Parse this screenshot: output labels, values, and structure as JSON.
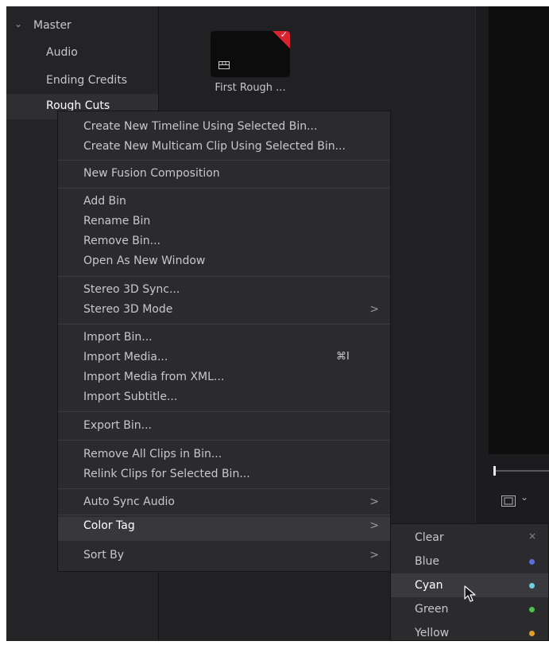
{
  "bins": {
    "master": "Master",
    "items": [
      "Audio",
      "Ending Credits",
      "Rough Cuts"
    ]
  },
  "clip": {
    "name": "First Rough ..."
  },
  "context_menu": {
    "create_timeline": "Create New Timeline Using Selected Bin...",
    "create_multicam": "Create New Multicam Clip Using Selected Bin...",
    "new_fusion": "New Fusion Composition",
    "add_bin": "Add Bin",
    "rename_bin": "Rename Bin",
    "remove_bin": "Remove Bin...",
    "open_window": "Open As New Window",
    "stereo_sync": "Stereo 3D Sync...",
    "stereo_mode": "Stereo 3D Mode",
    "import_bin": "Import Bin...",
    "import_media": "Import Media...",
    "import_media_shortcut": "⌘I",
    "import_xml": "Import Media from XML...",
    "import_subtitle": "Import Subtitle...",
    "export_bin": "Export Bin...",
    "remove_all": "Remove All Clips in Bin...",
    "relink": "Relink Clips for Selected Bin...",
    "auto_sync": "Auto Sync Audio",
    "color_tag": "Color Tag",
    "sort_by": "Sort By",
    "submenu_arrow": ">"
  },
  "color_submenu": {
    "items": [
      {
        "label": "Clear",
        "marker": "×"
      },
      {
        "label": "Blue",
        "color": "#5b6fd6"
      },
      {
        "label": "Cyan",
        "color": "#6fd0e0"
      },
      {
        "label": "Green",
        "color": "#4fc04f"
      },
      {
        "label": "Yellow",
        "color": "#e0a030"
      }
    ]
  },
  "colors": {
    "accent_red": "#d9232e",
    "menu_bg": "#2b2b2e",
    "highlight": "#38383c"
  }
}
